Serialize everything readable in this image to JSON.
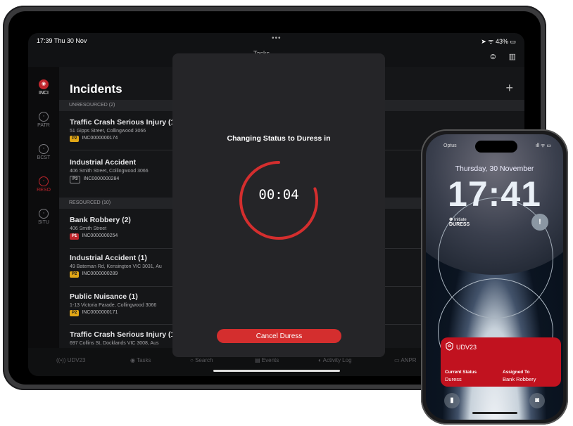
{
  "ipad": {
    "status": {
      "time": "17:39",
      "date": "Thu 30 Nov",
      "battery": "43%"
    },
    "header_title": "Tasks",
    "sidebar": [
      {
        "code": "INCI",
        "icon": "incident-icon"
      },
      {
        "code": "PATR",
        "icon": "patrol-icon"
      },
      {
        "code": "BCST",
        "icon": "broadcast-icon"
      },
      {
        "code": "RESO",
        "icon": "resource-icon"
      },
      {
        "code": "SITU",
        "icon": "situation-icon"
      }
    ],
    "page_title": "Incidents",
    "add_label": "+",
    "sections": {
      "unresourced": "UNRESOURCED (2)",
      "resourced": "RESOURCED (10)"
    },
    "incidents": [
      {
        "name": "Traffic Crash Serious Injury (1)",
        "address": "51 Gipps Street, Collingwood 3066",
        "priority": "P2",
        "id": "INC0000000174"
      },
      {
        "name": "Industrial Accident",
        "address": "406 Smith Street, Collingwood 3066",
        "priority": "P3",
        "id": "INC0000000284"
      },
      {
        "name": "Bank Robbery (2)",
        "address": "406 Smith Street",
        "priority": "P1",
        "id": "INC0000000254"
      },
      {
        "name": "Industrial Accident (1)",
        "address": "49 Bateman Rd, Kensington VIC 3031, Au",
        "priority": "P2",
        "id": "INC0000000289"
      },
      {
        "name": "Public Nuisance (1)",
        "address": "1-13 Victoria Parade, Collingwood 3066",
        "priority": "P2",
        "id": "INC0000000171"
      },
      {
        "name": "Traffic Crash Serious Injury (1)",
        "address": "697 Collins St, Docklands VIC 3008, Aus",
        "priority": "",
        "id": ""
      }
    ],
    "tabs": [
      {
        "label": "UDV23",
        "icon": "radio-icon"
      },
      {
        "label": "Tasks",
        "icon": "tasks-icon"
      },
      {
        "label": "Search",
        "icon": "search-icon"
      },
      {
        "label": "Events",
        "icon": "events-icon"
      },
      {
        "label": "Activity Log",
        "icon": "activity-icon"
      },
      {
        "label": "ANPR",
        "icon": "anpr-icon"
      }
    ],
    "modal": {
      "title": "Changing Status to Duress in",
      "countdown": "00:04",
      "progress": 0.8,
      "cancel_label": "Cancel Duress",
      "accent": "#d42e2e"
    }
  },
  "iphone": {
    "carrier": "Optus",
    "date": "Thursday, 30 November",
    "time": "17:41",
    "widget": {
      "small": "Initiate",
      "big": "DURESS"
    },
    "activity": {
      "app": "UDV23",
      "status_label": "Current Status",
      "status_value": "Duress",
      "assigned_label": "Assigned To",
      "assigned_value": "Bank Robbery",
      "color": "#c1121f"
    }
  }
}
